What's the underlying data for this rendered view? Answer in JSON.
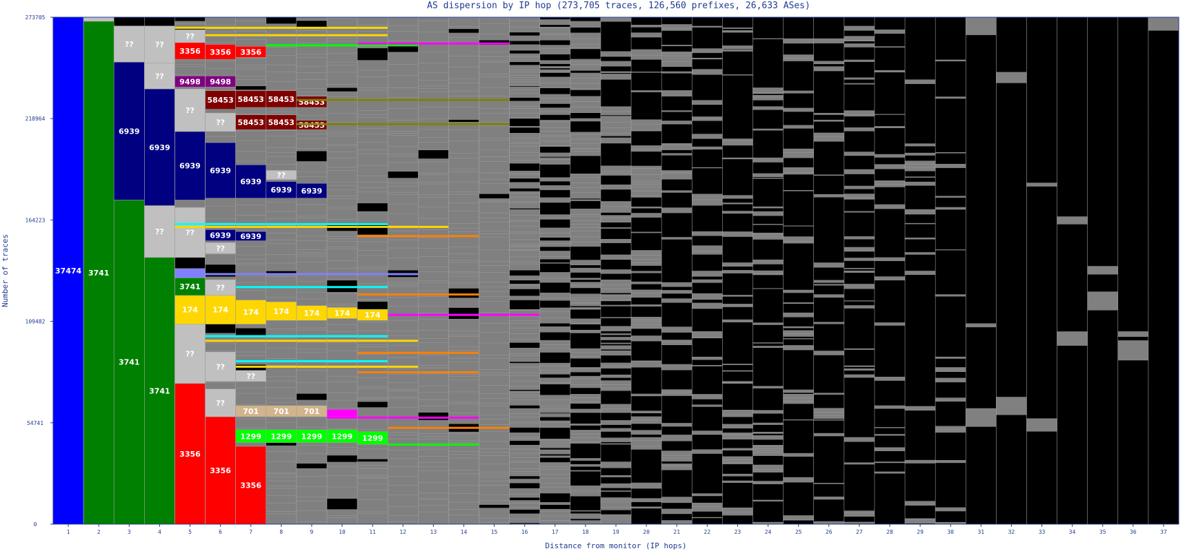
{
  "chart_data": {
    "type": "stacked-bar",
    "title": "AS dispersion by IP hop (273,705 traces, 126,560 prefixes, 26,633 ASes)",
    "xlabel": "Distance from monitor (IP hops)",
    "ylabel": "Number of traces",
    "ylim": [
      0,
      273705
    ],
    "y_ticks": [
      "0",
      "54741",
      "109482",
      "164223",
      "218964",
      "273705"
    ],
    "x_ticks": [
      "1",
      "2",
      "3",
      "4",
      "5",
      "6",
      "7",
      "8",
      "9",
      "10",
      "11",
      "12",
      "13",
      "14",
      "15",
      "16",
      "17",
      "18",
      "19",
      "20",
      "21",
      "22",
      "23",
      "24",
      "25",
      "26",
      "27",
      "28",
      "29",
      "30",
      "31",
      "32",
      "33",
      "34",
      "35",
      "36",
      "37"
    ],
    "colors": {
      "other_as": "#808080",
      "no_data": "#000000",
      "unknown": "#c0c0c0",
      "AS37474": "#0000ff",
      "AS3741": "#008000",
      "AS6939": "#000080",
      "AS3356": "#ff0000",
      "AS9498": "#800080",
      "AS58453": "#800000",
      "AS174": "#ffd700",
      "AS701": "#d2b48c",
      "AS1299": "#00ff00",
      "minor_olive": "#808000",
      "minor_orange": "#ff8000",
      "minor_magenta": "#ff00ff",
      "minor_cyan": "#00ffff",
      "minor_periwinkle": "#8080ff"
    },
    "segments": [
      {
        "hop": 1,
        "as": "AS37474",
        "label": "37474",
        "from": 0,
        "to": 273705
      },
      {
        "hop": 2,
        "as": "AS3741",
        "label": "3741",
        "from": 0,
        "to": 271500
      },
      {
        "hop": 2,
        "as": "unknown",
        "label": "",
        "from": 271500,
        "to": 273705
      },
      {
        "hop": 3,
        "as": "AS3741",
        "label": "3741",
        "from": 0,
        "to": 175000
      },
      {
        "hop": 3,
        "as": "AS6939",
        "label": "6939",
        "from": 175000,
        "to": 249500
      },
      {
        "hop": 3,
        "as": "unknown",
        "label": "??",
        "from": 249500,
        "to": 269000
      },
      {
        "hop": 4,
        "as": "AS3741",
        "label": "3741",
        "from": 0,
        "to": 144000
      },
      {
        "hop": 4,
        "as": "unknown",
        "label": "??",
        "from": 144000,
        "to": 172000
      },
      {
        "hop": 4,
        "as": "AS6939",
        "label": "6939",
        "from": 172000,
        "to": 235000
      },
      {
        "hop": 4,
        "as": "unknown",
        "label": "??",
        "from": 235000,
        "to": 249000
      },
      {
        "hop": 4,
        "as": "unknown",
        "label": "??",
        "from": 249000,
        "to": 269000
      },
      {
        "hop": 5,
        "as": "AS3356",
        "label": "3356",
        "from": 0,
        "to": 76000
      },
      {
        "hop": 5,
        "as": "unknown",
        "label": "??",
        "from": 76000,
        "to": 108000
      },
      {
        "hop": 5,
        "as": "AS174",
        "label": "174",
        "from": 108000,
        "to": 123500
      },
      {
        "hop": 5,
        "as": "AS3741",
        "label": "3741",
        "from": 123500,
        "to": 133000
      },
      {
        "hop": 5,
        "as": "minor_periwinkle",
        "label": "",
        "from": 133000,
        "to": 138000
      },
      {
        "hop": 5,
        "as": "no_data",
        "label": "",
        "from": 138000,
        "to": 144000
      },
      {
        "hop": 5,
        "as": "unknown",
        "label": "??",
        "from": 144000,
        "to": 171000
      },
      {
        "hop": 5,
        "as": "AS6939",
        "label": "6939",
        "from": 175000,
        "to": 212000
      },
      {
        "hop": 5,
        "as": "unknown",
        "label": "??",
        "from": 212000,
        "to": 235000
      },
      {
        "hop": 5,
        "as": "AS9498",
        "label": "9498",
        "from": 236000,
        "to": 242000
      },
      {
        "hop": 5,
        "as": "AS3356",
        "label": "3356",
        "from": 251000,
        "to": 260000
      },
      {
        "hop": 5,
        "as": "unknown",
        "label": "??",
        "from": 260000,
        "to": 267000
      },
      {
        "hop": 6,
        "as": "AS3356",
        "label": "3356",
        "from": 0,
        "to": 58000
      },
      {
        "hop": 6,
        "as": "unknown",
        "label": "??",
        "from": 58000,
        "to": 73000
      },
      {
        "hop": 6,
        "as": "unknown",
        "label": "??",
        "from": 77000,
        "to": 93000
      },
      {
        "hop": 6,
        "as": "AS174",
        "label": "174",
        "from": 108000,
        "to": 123500
      },
      {
        "hop": 6,
        "as": "unknown",
        "label": "??",
        "from": 123500,
        "to": 132000
      },
      {
        "hop": 6,
        "as": "unknown",
        "label": "??",
        "from": 146000,
        "to": 152000
      },
      {
        "hop": 6,
        "as": "AS6939",
        "label": "6939",
        "from": 153000,
        "to": 159000
      },
      {
        "hop": 6,
        "as": "AS6939",
        "label": "6939",
        "from": 176000,
        "to": 206000
      },
      {
        "hop": 6,
        "as": "unknown",
        "label": "??",
        "from": 212000,
        "to": 222000
      },
      {
        "hop": 6,
        "as": "AS58453",
        "label": "58453",
        "from": 224000,
        "to": 234000
      },
      {
        "hop": 6,
        "as": "AS9498",
        "label": "9498",
        "from": 236000,
        "to": 242000
      },
      {
        "hop": 6,
        "as": "AS3356",
        "label": "3356",
        "from": 251000,
        "to": 259000
      },
      {
        "hop": 7,
        "as": "AS3356",
        "label": "3356",
        "from": 0,
        "to": 42000
      },
      {
        "hop": 7,
        "as": "AS1299",
        "label": "1299",
        "from": 44000,
        "to": 51000
      },
      {
        "hop": 7,
        "as": "AS701",
        "label": "701",
        "from": 58000,
        "to": 64000
      },
      {
        "hop": 7,
        "as": "unknown",
        "label": "??",
        "from": 77000,
        "to": 83000
      },
      {
        "hop": 7,
        "as": "AS174",
        "label": "174",
        "from": 108000,
        "to": 121000
      },
      {
        "hop": 7,
        "as": "AS6939",
        "label": "6939",
        "from": 153000,
        "to": 158000
      },
      {
        "hop": 7,
        "as": "AS6939",
        "label": "6939",
        "from": 176000,
        "to": 194000
      },
      {
        "hop": 7,
        "as": "AS58453",
        "label": "58453",
        "from": 213000,
        "to": 221000
      },
      {
        "hop": 7,
        "as": "AS58453",
        "label": "58453",
        "from": 225000,
        "to": 234000
      },
      {
        "hop": 7,
        "as": "AS3356",
        "label": "3356",
        "from": 252000,
        "to": 258000
      },
      {
        "hop": 8,
        "as": "AS1299",
        "label": "1299",
        "from": 44000,
        "to": 51000
      },
      {
        "hop": 8,
        "as": "AS701",
        "label": "701",
        "from": 58000,
        "to": 64000
      },
      {
        "hop": 8,
        "as": "AS174",
        "label": "174",
        "from": 110000,
        "to": 120000
      },
      {
        "hop": 8,
        "as": "AS6939",
        "label": "6939",
        "from": 176000,
        "to": 185000
      },
      {
        "hop": 8,
        "as": "unknown",
        "label": "??",
        "from": 186000,
        "to": 191000
      },
      {
        "hop": 8,
        "as": "AS58453",
        "label": "58453",
        "from": 213000,
        "to": 221000
      },
      {
        "hop": 8,
        "as": "AS58453",
        "label": "58453",
        "from": 225000,
        "to": 234000
      },
      {
        "hop": 9,
        "as": "AS1299",
        "label": "1299",
        "from": 44000,
        "to": 51000
      },
      {
        "hop": 9,
        "as": "AS701",
        "label": "701",
        "from": 58000,
        "to": 64000
      },
      {
        "hop": 9,
        "as": "AS174",
        "label": "174",
        "from": 110000,
        "to": 118000
      },
      {
        "hop": 9,
        "as": "AS6939",
        "label": "6939",
        "from": 176000,
        "to": 184000
      },
      {
        "hop": 9,
        "as": "AS58453",
        "label": "58453",
        "from": 213000,
        "to": 218000
      },
      {
        "hop": 9,
        "as": "AS58453",
        "label": "58453",
        "from": 225000,
        "to": 231000
      },
      {
        "hop": 10,
        "as": "AS1299",
        "label": "1299",
        "from": 44000,
        "to": 51000
      },
      {
        "hop": 10,
        "as": "minor_magenta",
        "label": "",
        "from": 58000,
        "to": 62000
      },
      {
        "hop": 10,
        "as": "AS174",
        "label": "174",
        "from": 111000,
        "to": 117000
      },
      {
        "hop": 11,
        "as": "AS1299",
        "label": "1299",
        "from": 43000,
        "to": 50000
      },
      {
        "hop": 11,
        "as": "AS174",
        "label": "174",
        "from": 110000,
        "to": 116000
      }
    ]
  }
}
